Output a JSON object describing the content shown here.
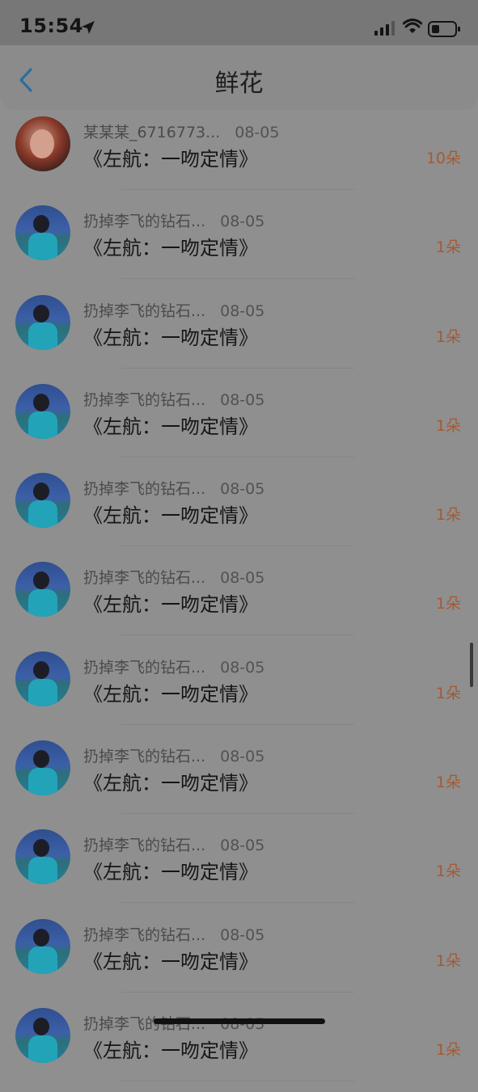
{
  "status": {
    "time": "15:54"
  },
  "nav": {
    "title": "鲜花"
  },
  "list": [
    {
      "name": "某某某_6716773...",
      "date": "08-05",
      "item": "《左航：一吻定情》",
      "count": "10朵",
      "avatar": "red"
    },
    {
      "name": "扔掉李飞的钻石...",
      "date": "08-05",
      "item": "《左航：一吻定情》",
      "count": "1朵",
      "avatar": "blue"
    },
    {
      "name": "扔掉李飞的钻石...",
      "date": "08-05",
      "item": "《左航：一吻定情》",
      "count": "1朵",
      "avatar": "blue"
    },
    {
      "name": "扔掉李飞的钻石...",
      "date": "08-05",
      "item": "《左航：一吻定情》",
      "count": "1朵",
      "avatar": "blue"
    },
    {
      "name": "扔掉李飞的钻石...",
      "date": "08-05",
      "item": "《左航：一吻定情》",
      "count": "1朵",
      "avatar": "blue"
    },
    {
      "name": "扔掉李飞的钻石...",
      "date": "08-05",
      "item": "《左航：一吻定情》",
      "count": "1朵",
      "avatar": "blue"
    },
    {
      "name": "扔掉李飞的钻石...",
      "date": "08-05",
      "item": "《左航：一吻定情》",
      "count": "1朵",
      "avatar": "blue"
    },
    {
      "name": "扔掉李飞的钻石...",
      "date": "08-05",
      "item": "《左航：一吻定情》",
      "count": "1朵",
      "avatar": "blue"
    },
    {
      "name": "扔掉李飞的钻石...",
      "date": "08-05",
      "item": "《左航：一吻定情》",
      "count": "1朵",
      "avatar": "blue"
    },
    {
      "name": "扔掉李飞的钻石...",
      "date": "08-05",
      "item": "《左航：一吻定情》",
      "count": "1朵",
      "avatar": "blue"
    },
    {
      "name": "扔掉李飞的钻石...",
      "date": "08-05",
      "item": "《左航：一吻定情》",
      "count": "1朵",
      "avatar": "blue"
    }
  ],
  "colors": {
    "accent": "#a55a33",
    "back_icon": "#2b6f9e"
  },
  "icons": {
    "back": "chevron-left-icon",
    "location": "location-arrow-icon",
    "signal": "cellular-signal-icon",
    "wifi": "wifi-icon",
    "battery": "battery-icon"
  }
}
